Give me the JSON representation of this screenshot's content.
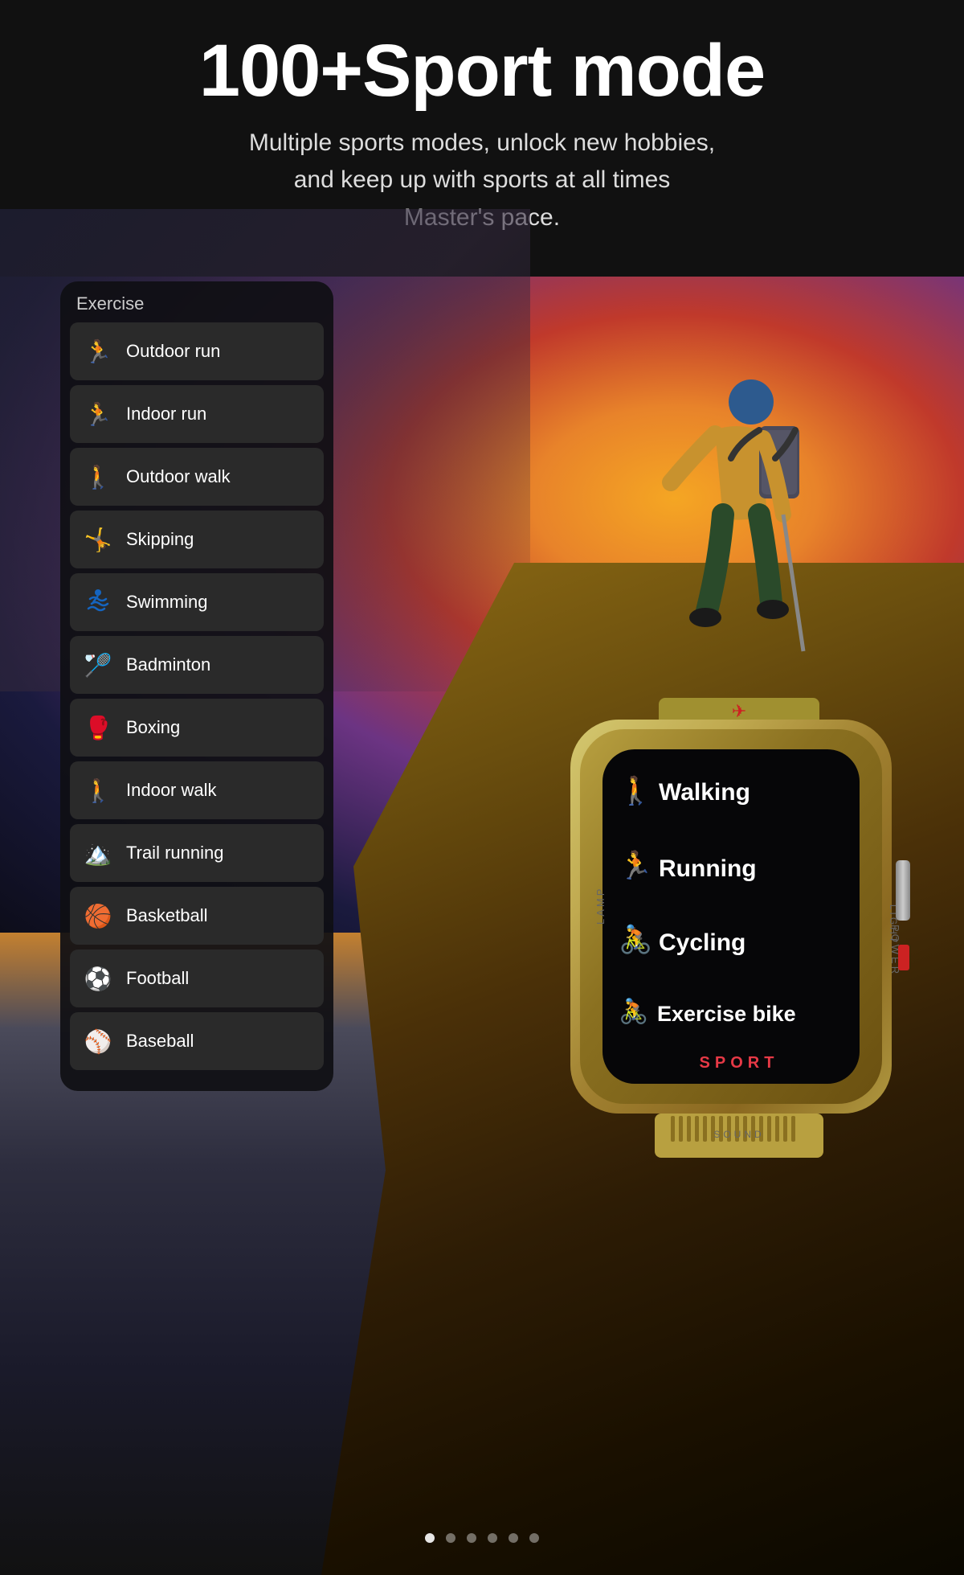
{
  "header": {
    "title": "100+Sport mode",
    "subtitle_line1": "Multiple sports modes, unlock new hobbies,",
    "subtitle_line2": "and keep up with sports at all times",
    "subtitle_line3": "Master's pace."
  },
  "exercise_panel": {
    "section_label": "Exercise",
    "items": [
      {
        "name": "Outdoor run",
        "icon": "🏃",
        "color": "#00bcd4"
      },
      {
        "name": "Indoor run",
        "icon": "🏃",
        "color": "#00bcd4"
      },
      {
        "name": "Outdoor walk",
        "icon": "🚶",
        "color": "#00bcd4"
      },
      {
        "name": "Skipping",
        "icon": "🤸",
        "color": "#00bcd4"
      },
      {
        "name": "Swimming",
        "icon": "🏊",
        "color": "#1565c0"
      },
      {
        "name": "Badminton",
        "icon": "🏸",
        "color": "#e65100"
      },
      {
        "name": "Boxing",
        "icon": "🥊",
        "color": "#c62828"
      },
      {
        "name": "Indoor walk",
        "icon": "🚶",
        "color": "#00bcd4"
      },
      {
        "name": "Trail running",
        "icon": "🏔️",
        "color": "#00897b"
      },
      {
        "name": "Basketball",
        "icon": "🏀",
        "color": "#ef6c00"
      },
      {
        "name": "Football",
        "icon": "⚽",
        "color": "#ef6c00"
      },
      {
        "name": "Baseball",
        "icon": "⚾",
        "color": "#6a1b9a"
      }
    ]
  },
  "watch": {
    "side_text_left": "LAMP",
    "side_text_right": "POWER",
    "bottom_text": "SOUND",
    "right_text": "LIGHT",
    "brand_label": "SPORT",
    "menu_items": [
      {
        "label": "Walking",
        "icon": "🚶",
        "color": "#00e5ff"
      },
      {
        "label": "Running",
        "icon": "🏃",
        "color": "#00e5ff"
      },
      {
        "label": "Cycling",
        "icon": "🚴",
        "color": "#ffd600"
      },
      {
        "label": "Exercise bike",
        "icon": "🚴",
        "color": "#00b0ff"
      }
    ]
  },
  "pagination": {
    "total": 6,
    "active_index": 0
  }
}
